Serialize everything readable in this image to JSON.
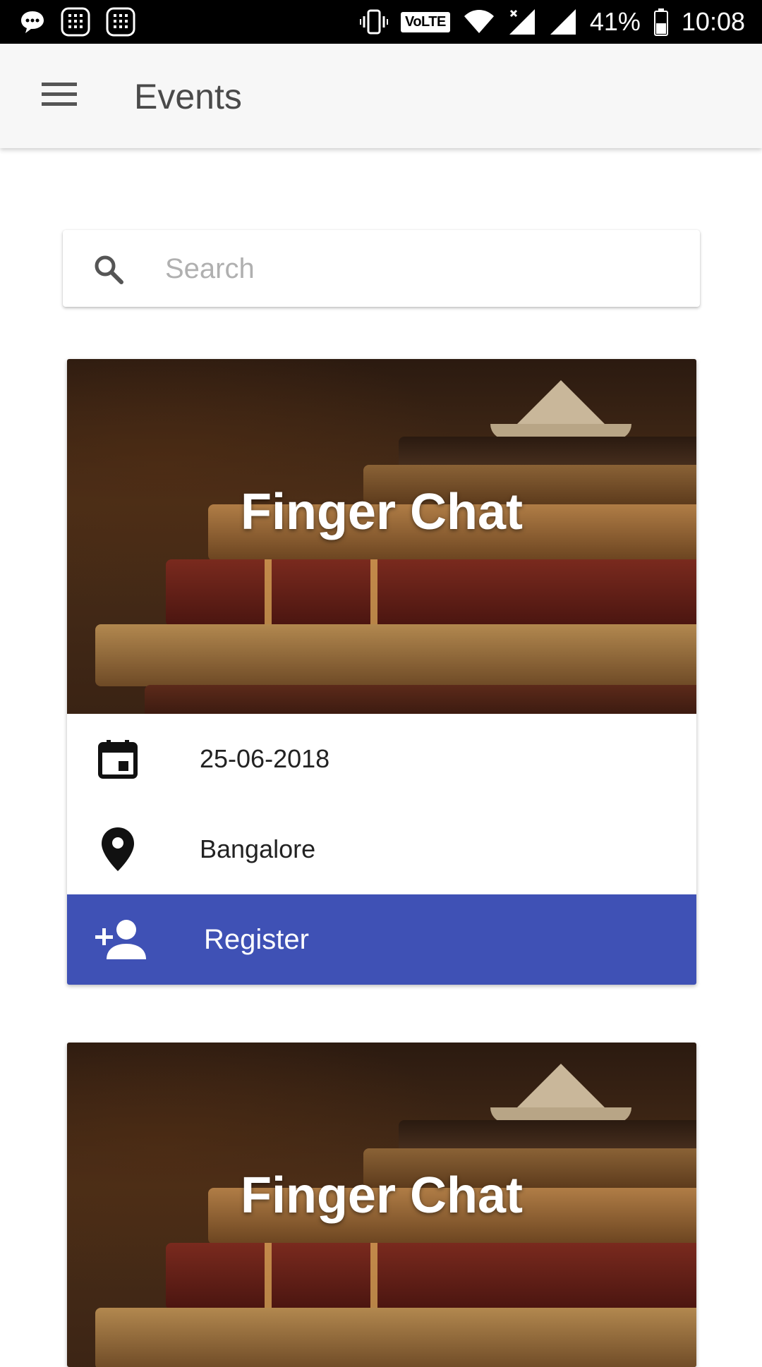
{
  "status_bar": {
    "battery_percent": "41%",
    "time": "10:08",
    "volte": "VoLTE",
    "left_icons": [
      "chat-bubble-icon",
      "dialpad-icon",
      "dialpad-icon"
    ],
    "right_icons": [
      "vibrate-icon",
      "volte-icon",
      "wifi-icon",
      "signal-no-data-icon",
      "signal-icon",
      "battery-icon"
    ]
  },
  "appbar": {
    "title": "Events",
    "menu_icon": "hamburger-menu-icon"
  },
  "search": {
    "placeholder": "Search",
    "value": "",
    "icon": "search-icon"
  },
  "events": [
    {
      "title": "Finger Chat",
      "date": "25-06-2018",
      "location": "Bangalore",
      "register_label": "Register"
    },
    {
      "title": "Finger Chat"
    }
  ],
  "colors": {
    "accent": "#3f51b5",
    "appbar_bg": "#f7f7f7",
    "statusbar_bg": "#000000"
  }
}
